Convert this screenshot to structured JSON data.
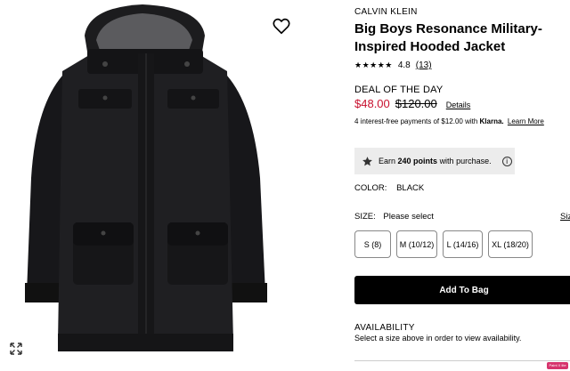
{
  "product": {
    "brand": "CALVIN KLEIN",
    "title": "Big Boys Resonance Military-Inspired Hooded Jacket",
    "rating_stars": "★★★★★",
    "rating": "4.8",
    "review_count": "(13)"
  },
  "pricing": {
    "deal_label": "DEAL OF THE DAY",
    "sale_price": "$48.00",
    "original_price": "$120.00",
    "details_link": "Details",
    "installments_prefix": "4 interest-free payments of $12.00 with",
    "klarna": "Klarna.",
    "learn_more": "Learn More",
    "sale_color": "#c8102e"
  },
  "rewards": {
    "earn": "Earn",
    "points": "240 points",
    "suffix": "with purchase.",
    "icon": "star-icon",
    "info": "i"
  },
  "color": {
    "label": "COLOR:",
    "value": "BLACK"
  },
  "size": {
    "label": "SIZE:",
    "value": "Please select",
    "guide_link": "Siz",
    "options": [
      "S (8)",
      "M (10/12)",
      "L (14/16)",
      "XL (18/20)"
    ]
  },
  "cart": {
    "add_label": "Add To Bag"
  },
  "availability": {
    "heading": "AVAILABILITY",
    "text": "Select a size above in order to view availability."
  },
  "icons": {
    "wishlist": "heart-icon",
    "expand": "expand-icon"
  },
  "overlay": {
    "badge": "Paint X lite"
  }
}
